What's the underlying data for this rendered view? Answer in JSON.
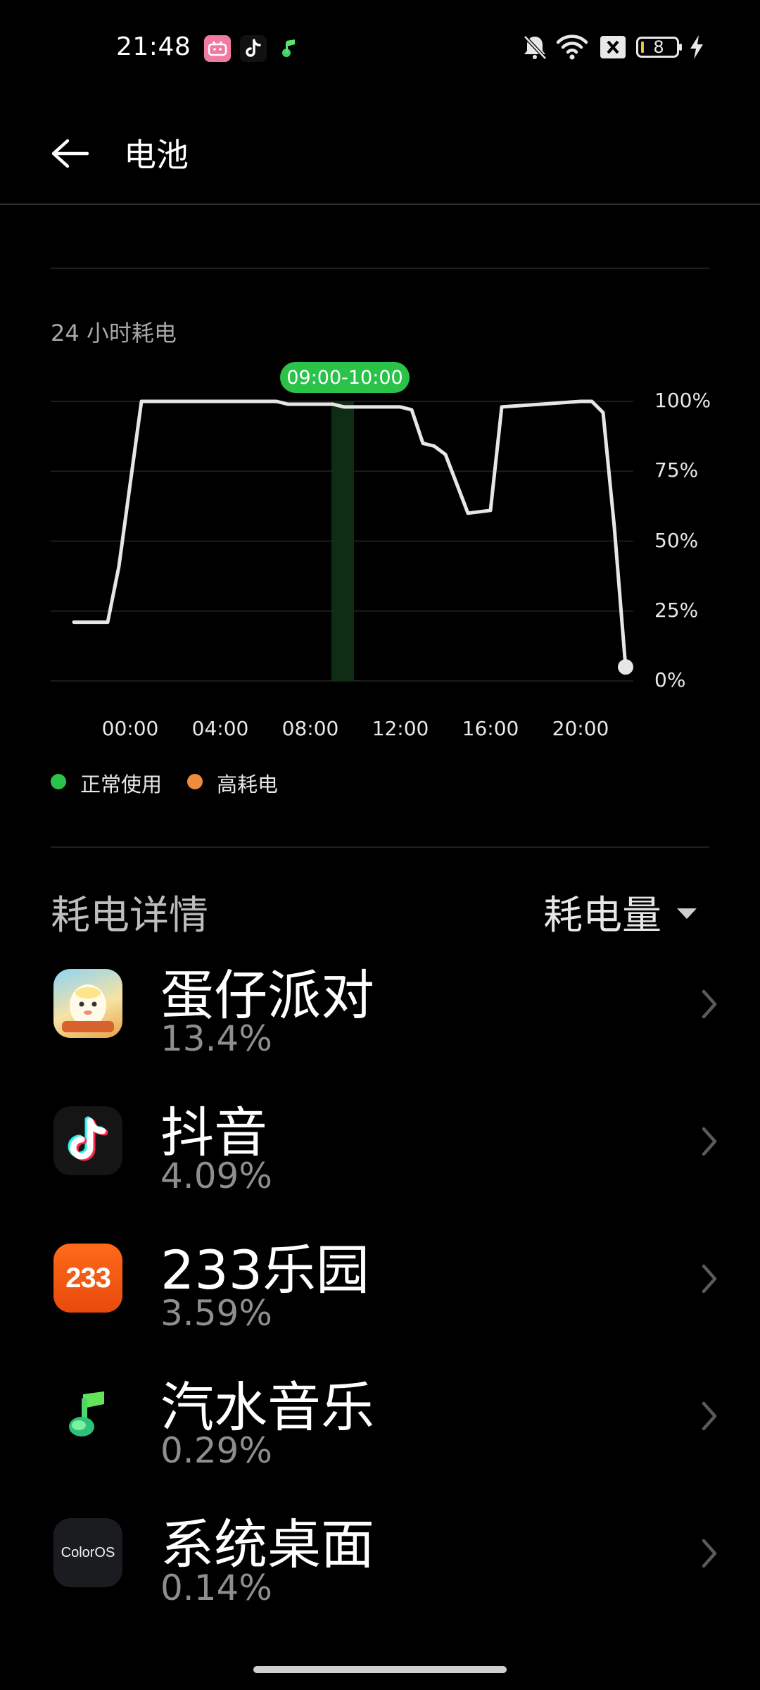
{
  "status_bar": {
    "time": "21:48",
    "notification_icons": [
      "bilibili-icon",
      "douyin-icon",
      "qishui-music-icon"
    ],
    "right_icons": [
      "mute-icon",
      "wifi-icon",
      "sim-off-icon",
      "battery-icon",
      "charging-icon"
    ],
    "battery_level": "8"
  },
  "header": {
    "title": "电池",
    "back_icon": "arrow-left-icon"
  },
  "chart_section": {
    "caption": "24 小时耗电",
    "tooltip": "09:00-10:00",
    "legend": [
      {
        "label": "正常使用",
        "color": "#2bc24a"
      },
      {
        "label": "高耗电",
        "color": "#f08a3c"
      }
    ]
  },
  "chart_data": {
    "type": "line",
    "title": "24 小时耗电",
    "x_tick_labels": [
      "00:00",
      "04:00",
      "08:00",
      "12:00",
      "16:00",
      "20:00"
    ],
    "y_tick_labels": [
      "100%",
      "75%",
      "50%",
      "25%",
      "0%"
    ],
    "ylim": [
      0,
      100
    ],
    "xlim_hours": [
      -3.5,
      21.5
    ],
    "selected_interval": "09:00-10:00",
    "series": [
      {
        "color": "#e6e6e6",
        "x_hours": [
          -2.5,
          -1,
          -0.5,
          0.5,
          6.5,
          7,
          9,
          9.5,
          10,
          12,
          12.5,
          13,
          13.5,
          14,
          15,
          16,
          16.5,
          20,
          20.5,
          21,
          21.5,
          22
        ],
        "values": [
          21,
          21,
          41,
          100,
          100,
          99,
          99,
          98,
          98,
          98,
          97,
          85,
          84,
          81,
          60,
          61,
          98,
          100,
          100,
          96,
          55,
          5
        ]
      }
    ],
    "end_point": {
      "x_hours": 22,
      "value": 5
    }
  },
  "details": {
    "title": "耗电详情",
    "sort_label": "耗电量",
    "apps": [
      {
        "name": "蛋仔派对",
        "percent": "13.4%",
        "icon": "eggy-party-icon"
      },
      {
        "name": "抖音",
        "percent": "4.09%",
        "icon": "douyin-icon"
      },
      {
        "name": "233乐园",
        "percent": "3.59%",
        "icon": "app-233-icon",
        "icon_text": "233"
      },
      {
        "name": "汽水音乐",
        "percent": "0.29%",
        "icon": "qishui-music-icon"
      },
      {
        "name": "系统桌面",
        "percent": "0.14%",
        "icon": "coloros-icon",
        "icon_text": "ColorOS"
      }
    ]
  }
}
